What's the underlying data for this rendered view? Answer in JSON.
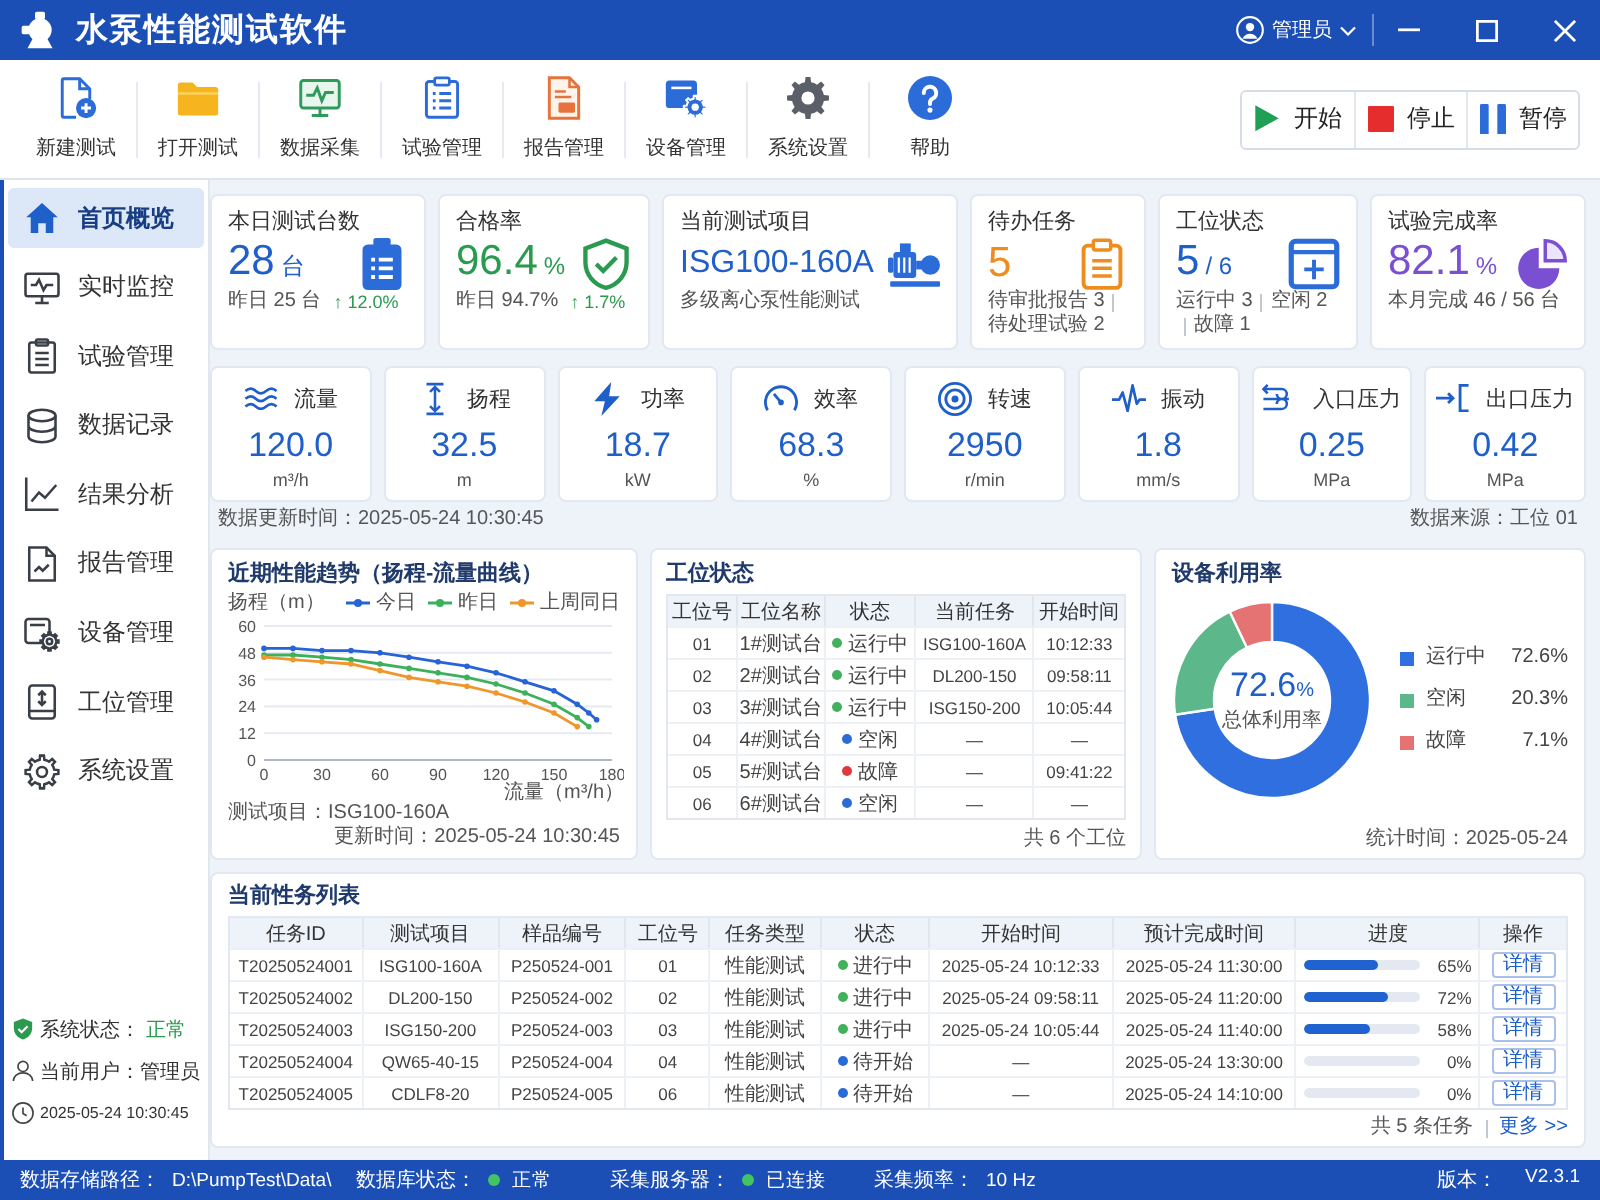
{
  "window": {
    "title": "水泵性能测试软件",
    "user": "管理员"
  },
  "toolbar": [
    {
      "kind": "new",
      "label": "新建测试"
    },
    {
      "kind": "open",
      "label": "打开测试"
    },
    {
      "kind": "collect",
      "label": "数据采集"
    },
    {
      "kind": "manage",
      "label": "试验管理"
    },
    {
      "kind": "report",
      "label": "报告管理"
    },
    {
      "kind": "device",
      "label": "设备管理"
    },
    {
      "kind": "settings",
      "label": "系统设置"
    },
    {
      "kind": "help",
      "label": "帮助"
    }
  ],
  "actions": [
    {
      "kind": "start",
      "label": "开始"
    },
    {
      "kind": "stop",
      "label": "停止"
    },
    {
      "kind": "pause",
      "label": "暂停"
    }
  ],
  "sidebar": {
    "items": [
      {
        "kind": "home",
        "label": "首页概览",
        "selected": true
      },
      {
        "kind": "monitor",
        "label": "实时监控",
        "selected": false
      },
      {
        "kind": "test",
        "label": "试验管理",
        "selected": false
      },
      {
        "kind": "database",
        "label": "数据记录",
        "selected": false
      },
      {
        "kind": "analysis",
        "label": "结果分析",
        "selected": false
      },
      {
        "kind": "report",
        "label": "报告管理",
        "selected": false
      },
      {
        "kind": "device",
        "label": "设备管理",
        "selected": false
      },
      {
        "kind": "station",
        "label": "工位管理",
        "selected": false
      },
      {
        "kind": "settings",
        "label": "系统设置",
        "selected": false
      }
    ],
    "status": [
      {
        "kind": "system",
        "label": "系统状态：",
        "value": "正常"
      },
      {
        "kind": "user",
        "label": "当前用户：管理员"
      },
      {
        "kind": "clock",
        "label": "2025-05-24 10:30:45"
      }
    ]
  },
  "kpis": [
    {
      "kind": "count",
      "title": "本日测试台数",
      "value": "28",
      "unit": "台",
      "notes": [
        "昨日 25 台"
      ],
      "trend": "↑ 12.0%"
    },
    {
      "kind": "rate",
      "title": "合格率",
      "value": "96.4",
      "unit": "%",
      "notes": [
        "昨日 94.7%"
      ],
      "trend": "↑ 1.7%"
    },
    {
      "kind": "project",
      "title": "当前测试项目",
      "value": "ISG100-160A",
      "notes": [
        "多级离心泵性能测试"
      ]
    },
    {
      "kind": "todo",
      "title": "待办任务",
      "value": "5",
      "notes": [
        "待审批报告 3",
        "待处理试验 2"
      ]
    },
    {
      "kind": "station",
      "title": "工位状态",
      "value": "5",
      "unit": "/ 6",
      "notes": [
        "运行中 3",
        "空闲 2",
        "故障 1"
      ]
    },
    {
      "kind": "completion",
      "title": "试验完成率",
      "value": "82.1",
      "unit": "%",
      "notes": [
        "本月完成 46 / 56 台"
      ]
    }
  ],
  "params": [
    {
      "kind": "flow",
      "label": "流量",
      "value": "120.0",
      "unit": "m³/h"
    },
    {
      "kind": "head",
      "label": "扬程",
      "value": "32.5",
      "unit": "m"
    },
    {
      "kind": "power",
      "label": "功率",
      "value": "18.7",
      "unit": "kW"
    },
    {
      "kind": "efficiency",
      "label": "效率",
      "value": "68.3",
      "unit": "%"
    },
    {
      "kind": "speed",
      "label": "转速",
      "value": "2950",
      "unit": "r/min"
    },
    {
      "kind": "vibration",
      "label": "振动",
      "value": "1.8",
      "unit": "mm/s"
    },
    {
      "kind": "inlet",
      "label": "入口压力",
      "value": "0.25",
      "unit": "MPa"
    },
    {
      "kind": "outlet",
      "label": "出口压力",
      "value": "0.42",
      "unit": "MPa"
    }
  ],
  "data_info": {
    "updated": "数据更新时间：2025-05-24 10:30:45",
    "source": "数据来源：工位 01"
  },
  "trend": {
    "chart_data": {
      "type": "line",
      "title": "近期性能趋势（扬程-流量曲线）",
      "xlabel": "流量（m³/h）",
      "ylabel": "扬程（m）",
      "x": [
        0,
        15,
        30,
        45,
        60,
        75,
        90,
        105,
        120,
        135,
        150,
        162,
        168,
        172
      ],
      "series": [
        {
          "name": "今日",
          "color": "#2563d6",
          "values": [
            50,
            50,
            49,
            49,
            48,
            46,
            44,
            42,
            39,
            35,
            31,
            25,
            21,
            18
          ]
        },
        {
          "name": "昨日",
          "color": "#3cb05a",
          "values": [
            47,
            47,
            46,
            45,
            43,
            41,
            39,
            37,
            34,
            30,
            25,
            19,
            15,
            null
          ]
        },
        {
          "name": "上周同日",
          "color": "#f0962a",
          "values": [
            46,
            45,
            44,
            43,
            40,
            37,
            35,
            33,
            30,
            26,
            21,
            15,
            null,
            null
          ]
        }
      ],
      "xlim": [
        0,
        180
      ],
      "ylim": [
        0,
        60
      ],
      "xticks": [
        0,
        30,
        60,
        90,
        120,
        150,
        180
      ],
      "yticks": [
        0,
        12,
        24,
        36,
        48,
        60
      ],
      "grid": true
    },
    "project": "测试项目：ISG100-160A",
    "updated": "更新时间：2025-05-24 10:30:45"
  },
  "stations": {
    "title": "工位状态",
    "columns": [
      "工位号",
      "工位名称",
      "状态",
      "当前任务",
      "开始时间"
    ],
    "rows": [
      {
        "id": "01",
        "name": "1#测试台",
        "status": "运行中",
        "color": "#43b05c",
        "task": "ISG100-160A",
        "start": "10:12:33"
      },
      {
        "id": "02",
        "name": "2#测试台",
        "status": "运行中",
        "color": "#43b05c",
        "task": "DL200-150",
        "start": "09:58:11"
      },
      {
        "id": "03",
        "name": "3#测试台",
        "status": "运行中",
        "color": "#43b05c",
        "task": "ISG150-200",
        "start": "10:05:44"
      },
      {
        "id": "04",
        "name": "4#测试台",
        "status": "空闲",
        "color": "#2a6bd8",
        "task": "—",
        "start": "—"
      },
      {
        "id": "05",
        "name": "5#测试台",
        "status": "故障",
        "color": "#e0383b",
        "task": "—",
        "start": "09:41:22"
      },
      {
        "id": "06",
        "name": "6#测试台",
        "status": "空闲",
        "color": "#2a6bd8",
        "task": "—",
        "start": "—"
      }
    ],
    "footer": "共 6 个工位"
  },
  "utilization": {
    "chart_data": {
      "type": "donut",
      "title": "设备利用率",
      "categories": [
        "运行中",
        "空闲",
        "故障"
      ],
      "values": [
        72.6,
        20.3,
        7.1
      ]
    },
    "center_value": "72.6",
    "center_unit": "%",
    "center_label": "总体利用率",
    "legend": [
      {
        "value": "72.6%",
        "color": "#2f6fe0"
      },
      {
        "value": "20.3%",
        "color": "#5cb88a"
      },
      {
        "value": "7.1%",
        "color": "#e57373"
      }
    ],
    "footer": "统计时间：2025-05-24"
  },
  "tasks": {
    "title": "当前性务列表",
    "columns": [
      "任务ID",
      "测试项目",
      "样品编号",
      "工位号",
      "任务类型",
      "状态",
      "开始时间",
      "预计完成时间",
      "进度",
      "操作"
    ],
    "rows": [
      {
        "id": "T20250524001",
        "project": "ISG100-160A",
        "sample": "P250524-001",
        "station": "01",
        "type": "性能测试",
        "status": "进行中",
        "color": "#43b05c",
        "start": "2025-05-24 10:12:33",
        "end": "2025-05-24 11:30:00",
        "level": 0.65,
        "progress": "65%",
        "action": "详情"
      },
      {
        "id": "T20250524002",
        "project": "DL200-150",
        "sample": "P250524-002",
        "station": "02",
        "type": "性能测试",
        "status": "进行中",
        "color": "#43b05c",
        "start": "2025-05-24 09:58:11",
        "end": "2025-05-24 11:20:00",
        "level": 0.72,
        "progress": "72%",
        "action": "详情"
      },
      {
        "id": "T20250524003",
        "project": "ISG150-200",
        "sample": "P250524-003",
        "station": "03",
        "type": "性能测试",
        "status": "进行中",
        "color": "#43b05c",
        "start": "2025-05-24 10:05:44",
        "end": "2025-05-24 11:40:00",
        "level": 0.58,
        "progress": "58%",
        "action": "详情"
      },
      {
        "id": "T20250524004",
        "project": "QW65-40-15",
        "sample": "P250524-004",
        "station": "04",
        "type": "性能测试",
        "status": "待开始",
        "color": "#2a6bd8",
        "start": "—",
        "end": "2025-05-24 13:30:00",
        "level": 0,
        "progress": "0%",
        "action": "详情"
      },
      {
        "id": "T20250524005",
        "project": "CDLF8-20",
        "sample": "P250524-005",
        "station": "06",
        "type": "性能测试",
        "status": "待开始",
        "color": "#2a6bd8",
        "start": "—",
        "end": "2025-05-24 14:10:00",
        "level": 0,
        "progress": "0%",
        "action": "详情"
      }
    ],
    "count": "共 5 条任务",
    "more": "更多 >>"
  },
  "status_bar": {
    "items": [
      {
        "label": "数据存储路径：",
        "value": "D:\\PumpTest\\Data\\"
      },
      {
        "label": "数据库状态：",
        "value": "正常",
        "color": "#43c463"
      },
      {
        "label": "采集服务器：",
        "value": "已连接",
        "color": "#43c463"
      },
      {
        "label": "采集频率：",
        "value": "10 Hz"
      }
    ],
    "version_label": "版本：",
    "version": "V2.3.1"
  }
}
